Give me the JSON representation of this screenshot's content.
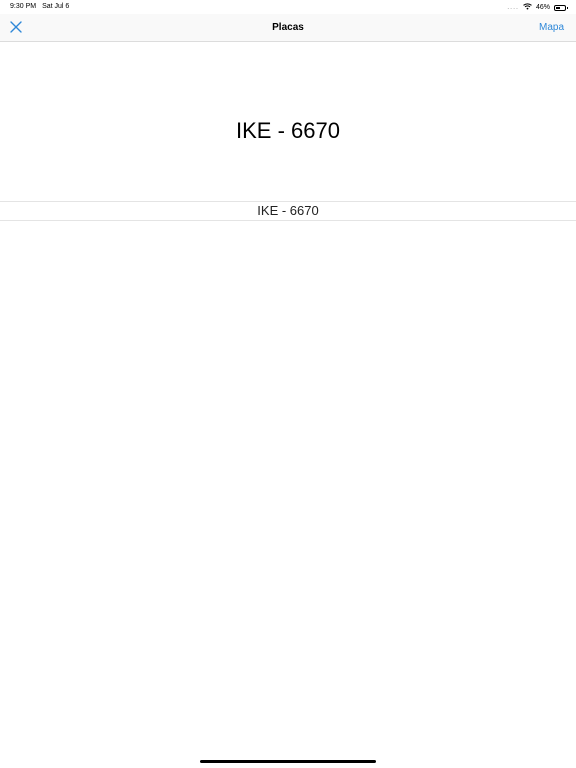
{
  "status_bar": {
    "time": "9:30 PM",
    "date": "Sat Jul 6",
    "signal": "....",
    "wifi_icon": "wifi-icon",
    "battery_percent": "46%",
    "battery_level": 0.46
  },
  "nav": {
    "close_icon": "close-icon",
    "title": "Placas",
    "map_label": "Mapa",
    "accent_color": "#2f88d8"
  },
  "plate": {
    "header": "IKE - 6670",
    "items": [
      {
        "label": "IKE - 6670"
      }
    ]
  }
}
